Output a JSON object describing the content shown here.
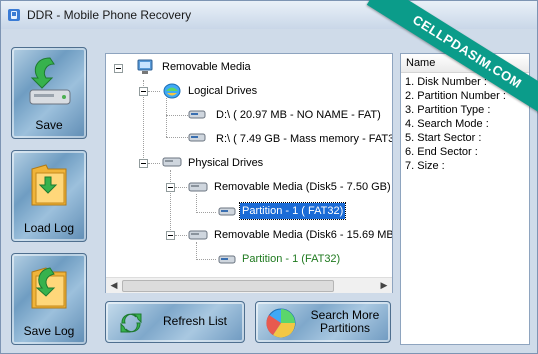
{
  "window": {
    "title": "DDR - Mobile Phone Recovery",
    "watermark": "CELLPDASIM.COM"
  },
  "sidebar": {
    "buttons": [
      {
        "label": "Save",
        "icon": "drive-save-icon"
      },
      {
        "label": "Load Log",
        "icon": "folder-load-icon"
      },
      {
        "label": "Save Log",
        "icon": "folder-save-icon"
      }
    ]
  },
  "tree": {
    "root": "Removable Media",
    "logical_label": "Logical Drives",
    "logical": [
      "D:\\ ( 20.97 MB - NO NAME - FAT)",
      "R:\\ (  7.49 GB - Mass memory - FAT32)"
    ],
    "physical_label": "Physical Drives",
    "disks": [
      {
        "label": "Removable Media (Disk5 - 7.50 GB)",
        "partition": "Partition - 1 ( FAT32)"
      },
      {
        "label": "Removable Media (Disk6 - 15.69 MB)",
        "partition": "Partition - 1 (FAT32)"
      }
    ]
  },
  "properties": {
    "header": "Name",
    "lines": [
      "1. Disk Number :",
      "2. Partition Number :",
      "3. Partition Type :",
      "4. Search Mode :",
      "5. Start Sector :",
      "6. End Sector :",
      "7. Size :"
    ]
  },
  "actions": {
    "refresh": "Refresh List",
    "search_line1": "Search More",
    "search_line2": "Partitions"
  },
  "colors": {
    "selection": "#1b6bd6",
    "partition_text": "#1f7a1f",
    "ribbon": "#0b9c8a"
  }
}
